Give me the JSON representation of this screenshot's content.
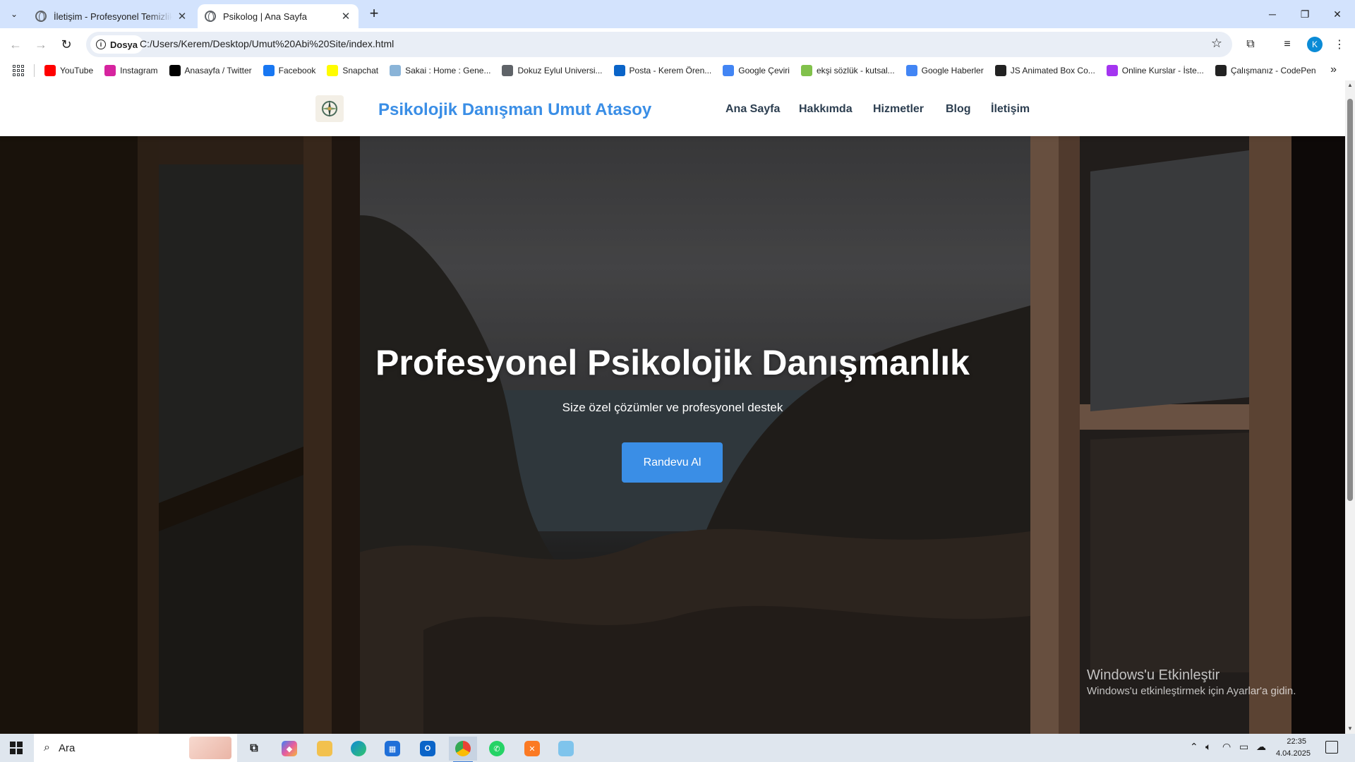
{
  "browser": {
    "tabs": [
      {
        "title": "İletişim - Profesyonel Temizlik Hizmetleri",
        "active": false
      },
      {
        "title": "Psikolog | Ana Sayfa",
        "active": true
      }
    ],
    "site_chip": "Dosya",
    "url": "C:/Users/Kerem/Desktop/Umut%20Abi%20Site/index.html",
    "profile_initial": "K",
    "bookmarks": [
      {
        "label": "YouTube",
        "icon": "youtube-icon",
        "color": "#ff0000"
      },
      {
        "label": "Instagram",
        "icon": "instagram-icon",
        "color": "#d6249f"
      },
      {
        "label": "Anasayfa / Twitter",
        "icon": "x-icon",
        "color": "#000000"
      },
      {
        "label": "Facebook",
        "icon": "facebook-icon",
        "color": "#1877f2"
      },
      {
        "label": "Snapchat",
        "icon": "snapchat-icon",
        "color": "#fffc00"
      },
      {
        "label": "Sakai : Home : Gene...",
        "icon": "sakai-icon",
        "color": "#8ab4d8"
      },
      {
        "label": "Dokuz Eylul Universi...",
        "icon": "globe-icon",
        "color": "#5f6368"
      },
      {
        "label": "Posta - Kerem Ören...",
        "icon": "outlook-icon",
        "color": "#0a64c8"
      },
      {
        "label": "Google Çeviri",
        "icon": "translate-icon",
        "color": "#4285f4"
      },
      {
        "label": "ekşi sözlük - kutsal...",
        "icon": "eksi-icon",
        "color": "#81c14b"
      },
      {
        "label": "Google Haberler",
        "icon": "news-icon",
        "color": "#4285f4"
      },
      {
        "label": "JS Animated Box Co...",
        "icon": "codepen-icon",
        "color": "#222222"
      },
      {
        "label": "Online Kurslar - İste...",
        "icon": "udemy-icon",
        "color": "#a435f0"
      },
      {
        "label": "Çalışmanız - CodePen",
        "icon": "codepen-icon",
        "color": "#222222"
      }
    ]
  },
  "site": {
    "brand": "Psikolojik Danışman Umut Atasoy",
    "menu": [
      "Ana Sayfa",
      "Hakkımda",
      "Hizmetler",
      "Blog",
      "İletişim"
    ],
    "hero": {
      "title": "Profesyonel Psikolojik Danışmanlık",
      "subtitle": "Size özel çözümler ve profesyonel destek",
      "cta": "Randevu Al"
    },
    "accent_color": "#3a8ee6"
  },
  "os": {
    "watermark_title": "Windows'u Etkinleştir",
    "watermark_text": "Windows'u etkinleştirmek için Ayarlar'a gidin.",
    "search_placeholder": "Ara",
    "time": "22:35",
    "date": "4.04.2025"
  }
}
